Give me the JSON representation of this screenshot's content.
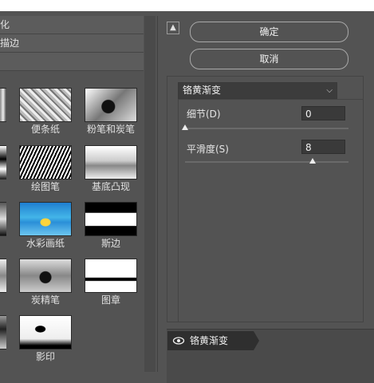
{
  "gallery": {
    "categories": [
      "化",
      "描边"
    ],
    "items": [
      {
        "label": "便条纸"
      },
      {
        "label": "粉笔和炭笔"
      },
      {
        "label": "绘图笔"
      },
      {
        "label": "基底凸现"
      },
      {
        "label": "水彩画纸"
      },
      {
        "label": "斯边"
      },
      {
        "label": "炭精笔"
      },
      {
        "label": "图章"
      },
      {
        "label": "影印"
      }
    ]
  },
  "buttons": {
    "ok": "确定",
    "cancel": "取消"
  },
  "filter": {
    "selected": "铬黄渐变",
    "params": [
      {
        "label": "细节(D)",
        "value": "0",
        "slider_fraction": 0.0
      },
      {
        "label": "平滑度(S)",
        "value": "8",
        "slider_fraction": 0.78
      }
    ]
  },
  "layers": [
    {
      "name": "铬黄渐变",
      "visible": true
    }
  ],
  "icons": {
    "collapse": "collapse-up-icon",
    "dropdown": "chevron-down-icon",
    "visibility": "eye-icon"
  }
}
